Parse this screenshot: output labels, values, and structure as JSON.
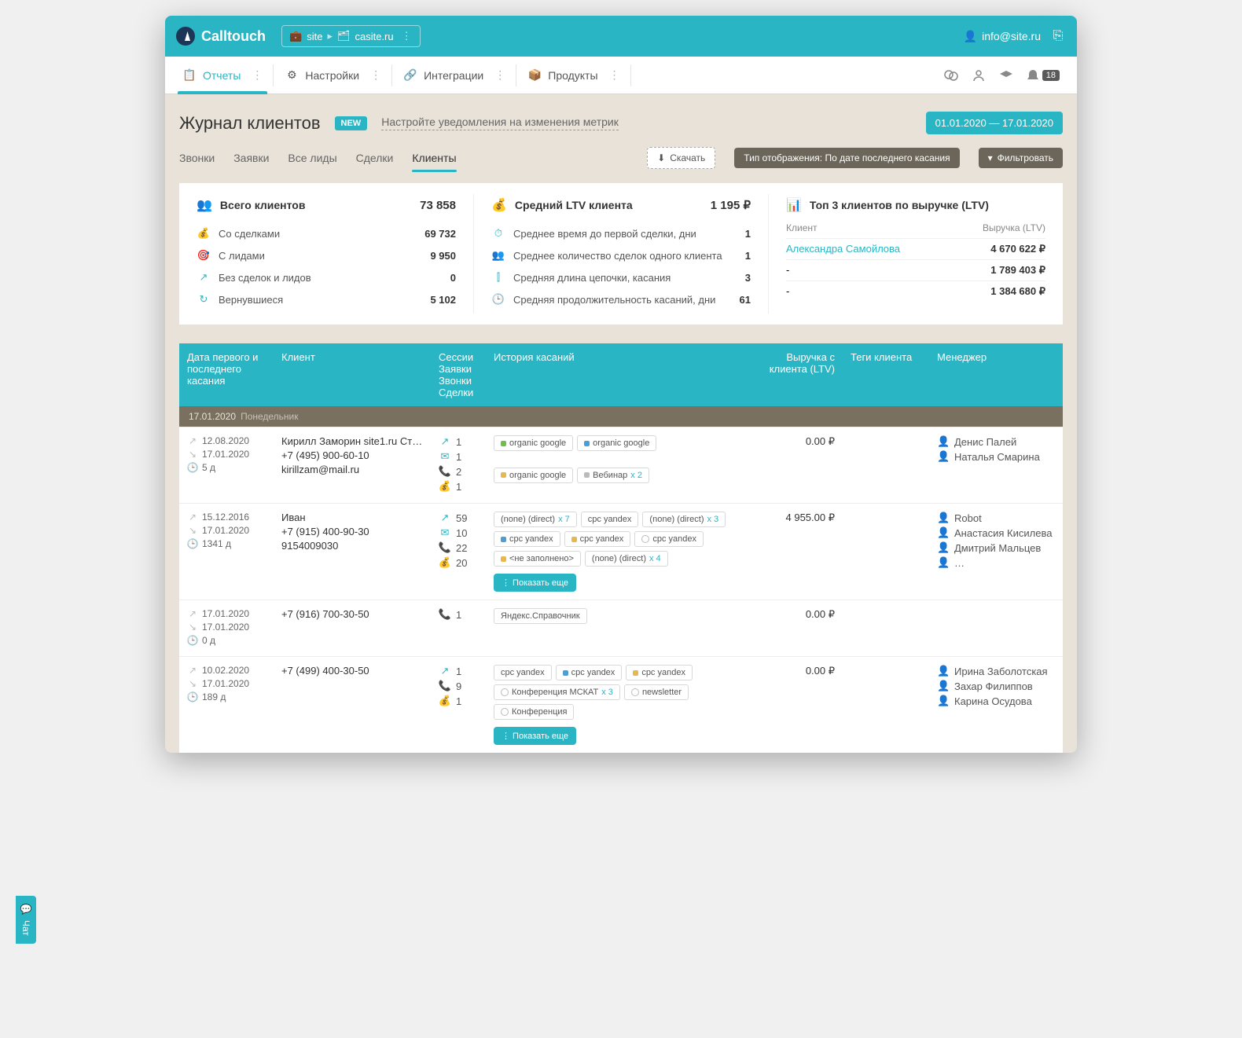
{
  "topbar": {
    "brand": "Calltouch",
    "site_label": "site",
    "site_value": "casite.ru",
    "user_email": "info@site.ru"
  },
  "menu": {
    "items": [
      "Отчеты",
      "Настройки",
      "Интеграции",
      "Продукты"
    ],
    "notif_count": "18"
  },
  "heading": {
    "title": "Журнал клиентов",
    "new": "NEW",
    "notice": "Настройте уведомления на изменения метрик",
    "daterange": "01.01.2020  —  17.01.2020"
  },
  "tabs": {
    "items": [
      "Звонки",
      "Заявки",
      "Все лиды",
      "Сделки",
      "Клиенты"
    ],
    "download": "Скачать",
    "display": "Тип отображения: По дате последнего касания",
    "filter": "Фильтровать"
  },
  "stats": {
    "col1": {
      "title": "Всего клиентов",
      "value": "73 858",
      "rows": [
        [
          "Со сделками",
          "69 732"
        ],
        [
          "С лидами",
          "9 950"
        ],
        [
          "Без сделок и лидов",
          "0"
        ],
        [
          "Вернувшиеся",
          "5 102"
        ]
      ]
    },
    "col2": {
      "title": "Средний LTV клиента",
      "value": "1 195 ₽",
      "rows": [
        [
          "Среднее время до первой сделки, дни",
          "1"
        ],
        [
          "Среднее количество сделок одного клиента",
          "1"
        ],
        [
          "Средняя длина цепочки, касания",
          "3"
        ],
        [
          "Средняя продолжительность касаний, дни",
          "61"
        ]
      ]
    },
    "col3": {
      "title": "Топ 3 клиентов по выручке (LTV)",
      "h_client": "Клиент",
      "h_ltv": "Выручка (LTV)",
      "rows": [
        [
          "Александра Самойлова",
          "4 670 622 ₽"
        ],
        [
          "-",
          "1 789 403 ₽"
        ],
        [
          "-",
          "1 384 680 ₽"
        ]
      ]
    }
  },
  "table": {
    "head": {
      "date": "Дата первого и последнего касания",
      "client": "Клиент",
      "sess": "Сессии\nЗаявки\nЗвонки\nСделки",
      "hist": "История касаний",
      "ltv": "Выручка с клиента (LTV)",
      "tags": "Теги клиента",
      "mgr": "Менеджер"
    },
    "day": {
      "date": "17.01.2020",
      "weekday": "Понедельник"
    },
    "showmore": "Показать еще",
    "rows": [
      {
        "dates": [
          "12.08.2020",
          "17.01.2020",
          "5 д"
        ],
        "client": [
          "Кирилл Заморин site1.ru Ст…",
          "+7 (495) 900-60-10",
          "kirillzam@mail.ru"
        ],
        "sess": [
          1,
          1,
          2,
          1
        ],
        "chips": [
          {
            "c": "g",
            "t": "organic google"
          },
          {
            "c": "b",
            "t": "organic google"
          },
          {
            "c": "y",
            "t": "organic google"
          },
          {
            "c": "gr",
            "t": "Вебинар",
            "cnt": "x 2"
          }
        ],
        "ltv": "0.00 ₽",
        "mgr": [
          "Денис Палей",
          "Наталья Смарина"
        ]
      },
      {
        "dates": [
          "15.12.2016",
          "17.01.2020",
          "1341 д"
        ],
        "client": [
          "Иван",
          "+7 (915) 400-90-30",
          "9154009030"
        ],
        "sess": [
          59,
          10,
          22,
          20
        ],
        "chips": [
          {
            "t": "(none) (direct)",
            "cnt": "x 7"
          },
          {
            "t": "cpc yandex"
          },
          {
            "t": "(none) (direct)",
            "cnt": "x 3"
          },
          {
            "c": "b",
            "t": "cpc yandex"
          },
          {
            "c": "y",
            "t": "cpc yandex"
          },
          {
            "clock": true,
            "t": "cpc yandex"
          },
          {
            "c": "y",
            "t": "<не заполнено>"
          },
          {
            "t": "(none) (direct)",
            "cnt": "x 4"
          }
        ],
        "more": true,
        "ltv": "4 955.00 ₽",
        "mgr": [
          "Robot",
          "Анастасия Кисилева",
          "Дмитрий Мальцев",
          "…"
        ]
      },
      {
        "dates": [
          "17.01.2020",
          "17.01.2020",
          "0 д"
        ],
        "client": [
          "+7 (916) 700-30-50"
        ],
        "sess": [
          null,
          null,
          1,
          null
        ],
        "chips": [
          {
            "t": "Яндекс.Справочник"
          }
        ],
        "ltv": "0.00 ₽",
        "mgr": []
      },
      {
        "dates": [
          "10.02.2020",
          "17.01.2020",
          "189 д"
        ],
        "client": [
          "+7 (499) 400-30-50"
        ],
        "sess": [
          1,
          null,
          9,
          1
        ],
        "chips": [
          {
            "t": "cpc yandex"
          },
          {
            "c": "b",
            "t": "cpc yandex"
          },
          {
            "c": "y",
            "t": "cpc yandex"
          },
          {
            "t": "Конференция МСКАТ",
            "cnt": "x 3",
            "clock": true
          },
          {
            "t": "newsletter",
            "clock": true
          },
          {
            "t": "Конференция",
            "clock": true
          }
        ],
        "more": true,
        "ltv": "0.00 ₽",
        "mgr": [
          "Ирина Заболотская",
          "Захар Филиппов",
          "Карина Осудова"
        ]
      }
    ]
  },
  "chat": "Чат"
}
